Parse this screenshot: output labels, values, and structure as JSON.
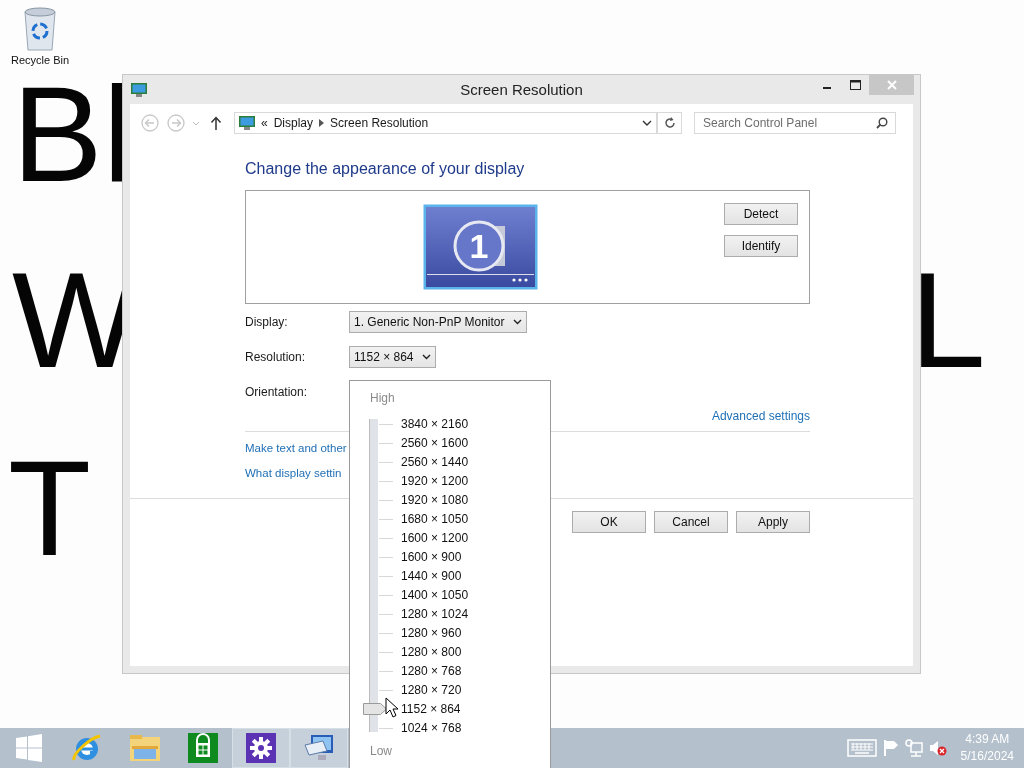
{
  "desktop": {
    "wallpaper_text": [
      {
        "text": "Bl"
      },
      {
        "text": "W"
      },
      {
        "text": "L"
      },
      {
        "text": "T"
      }
    ],
    "icons": [
      {
        "label": "Recycle Bin"
      }
    ]
  },
  "window": {
    "title": "Screen Resolution",
    "address": {
      "overflow": "«",
      "crumbs": [
        "Display",
        "Screen Resolution"
      ]
    },
    "search": {
      "placeholder": "Search Control Panel"
    },
    "heading": "Change the appearance of your display",
    "monitor_number": "1",
    "monitor_buttons": [
      "Detect",
      "Identify"
    ],
    "fields": [
      {
        "label": "Display:",
        "value": "1. Generic Non-PnP Monitor"
      },
      {
        "label": "Resolution:",
        "value": "1152 × 864"
      },
      {
        "label": "Orientation:"
      }
    ],
    "advanced_link": "Advanced settings",
    "links": [
      "Make text and other",
      "What display settin"
    ],
    "buttons": [
      "OK",
      "Cancel",
      "Apply"
    ]
  },
  "resolution_popup": {
    "high_label": "High",
    "low_label": "Low",
    "level": 0.0625,
    "options": [
      "3840 × 2160",
      "2560 × 1600",
      "2560 × 1440",
      "1920 × 1200",
      "1920 × 1080",
      "1680 × 1050",
      "1600 × 1200",
      "1600 × 900",
      "1440 × 900",
      "1400 × 1050",
      "1280 × 1024",
      "1280 × 960",
      "1280 × 800",
      "1280 × 768",
      "1280 × 720",
      "1152 × 864",
      "1024 × 768"
    ]
  },
  "taskbar": {
    "apps": [
      {
        "kind": "start",
        "running": false
      },
      {
        "kind": "browser",
        "running": false
      },
      {
        "kind": "folder",
        "running": false
      },
      {
        "kind": "store",
        "running": false
      },
      {
        "kind": "settings",
        "running": true
      },
      {
        "kind": "control-panel",
        "running": true
      }
    ],
    "tray": [
      {
        "kind": "keyboard"
      },
      {
        "kind": "flag"
      },
      {
        "kind": "network"
      },
      {
        "kind": "volume-muted"
      }
    ],
    "time": "4:39 AM",
    "date": "5/16/2024"
  }
}
